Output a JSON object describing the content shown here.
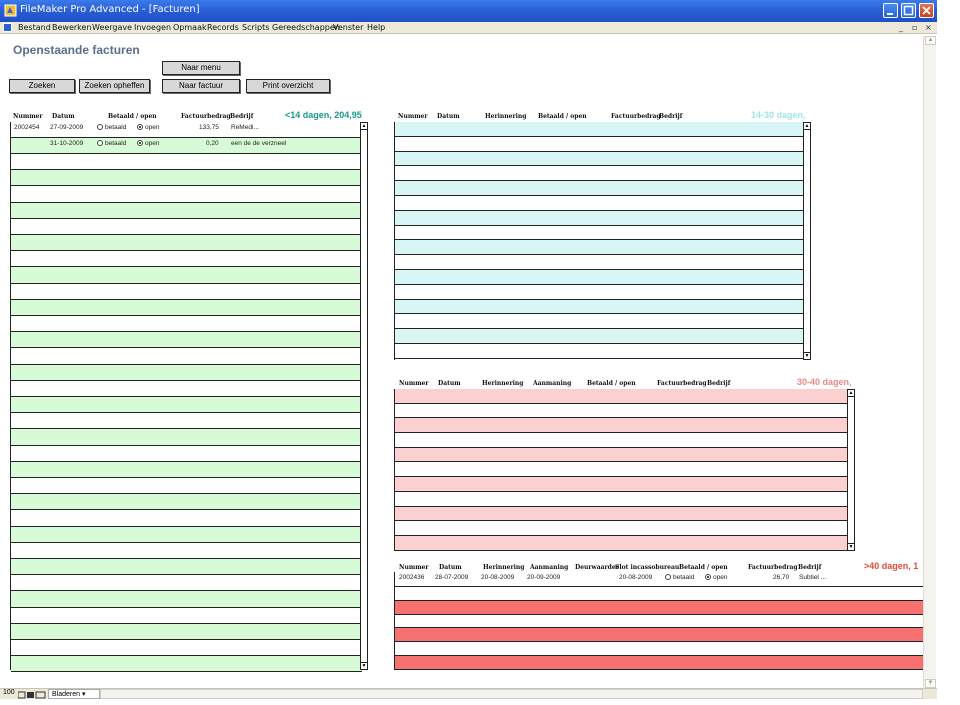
{
  "window": {
    "title": "FileMaker Pro Advanced - [Facturen]"
  },
  "menu": {
    "items": [
      "Bestand",
      "Bewerken",
      "Weergave",
      "Invoegen",
      "Opmaak",
      "Records",
      "Scripts",
      "Gereedschappen",
      "Venster",
      "Help"
    ]
  },
  "page": {
    "title": "Openstaande facturen"
  },
  "buttons": {
    "naar_menu": "Naar menu",
    "zoeken": "Zoeken",
    "zoeken_opheffen": "Zoeken opheffen",
    "naar_factuur": "Naar factuur",
    "print_overzicht": "Print overzicht"
  },
  "portal_lt14": {
    "title": "<14 dagen, 204,95",
    "title_color": "#1a9a8a",
    "row_color": "#d7fbd7",
    "headers": [
      "Nummer",
      "Datum",
      "Betaald / open",
      "Factuurbedrag",
      "Bedrijf"
    ],
    "rows": [
      {
        "nummer": "2002454",
        "datum": "27-09-2009",
        "betaald": "betaald",
        "open": "open",
        "bedrag": "133,75",
        "bedrijf": "ReMedi..."
      },
      {
        "nummer": "",
        "datum": "31-10-2009",
        "betaald": "betaald",
        "open": "open",
        "bedrag": "0,20",
        "bedrijf": "een de de verzneel"
      }
    ]
  },
  "portal_14_30": {
    "title": "14-30 dagen,",
    "title_color": "#9ee6e6",
    "row_color": "#d9f6f6",
    "headers": [
      "Nummer",
      "Datum",
      "Herinnering",
      "Betaald / open",
      "Factuurbedrag",
      "Bedrijf"
    ]
  },
  "portal_30_40": {
    "title": "30-40 dagen,",
    "title_color": "#e88a8a",
    "row_color": "#fbd0d0",
    "headers": [
      "Nummer",
      "Datum",
      "Herinnering",
      "Aanmaning",
      "Betaald / open",
      "Factuurbedrag",
      "Bedrijf"
    ]
  },
  "portal_gt40": {
    "title": ">40 dagen, 1",
    "title_color": "#e24b3a",
    "row_color": "#f87171",
    "headers": [
      "Nummer",
      "Datum",
      "Herinnering",
      "Aanmaning",
      "Deurwaarder",
      "Slot incassobureau",
      "Betaald / open",
      "Factuurbedrag",
      "Bedrijf"
    ],
    "rows": [
      {
        "nummer": "2002436",
        "datum": "28-07-2009",
        "herinnering": "20-08-2009",
        "aanmaning": "20-09-2009",
        "deurwaarder": "",
        "incasso": "20-08-2009",
        "betaald": "betaald",
        "open": "open",
        "bedrag": "26,70",
        "bedrijf": "Subtiel ..."
      }
    ]
  },
  "status": {
    "zoom": "100",
    "mode": "Bladeren"
  }
}
